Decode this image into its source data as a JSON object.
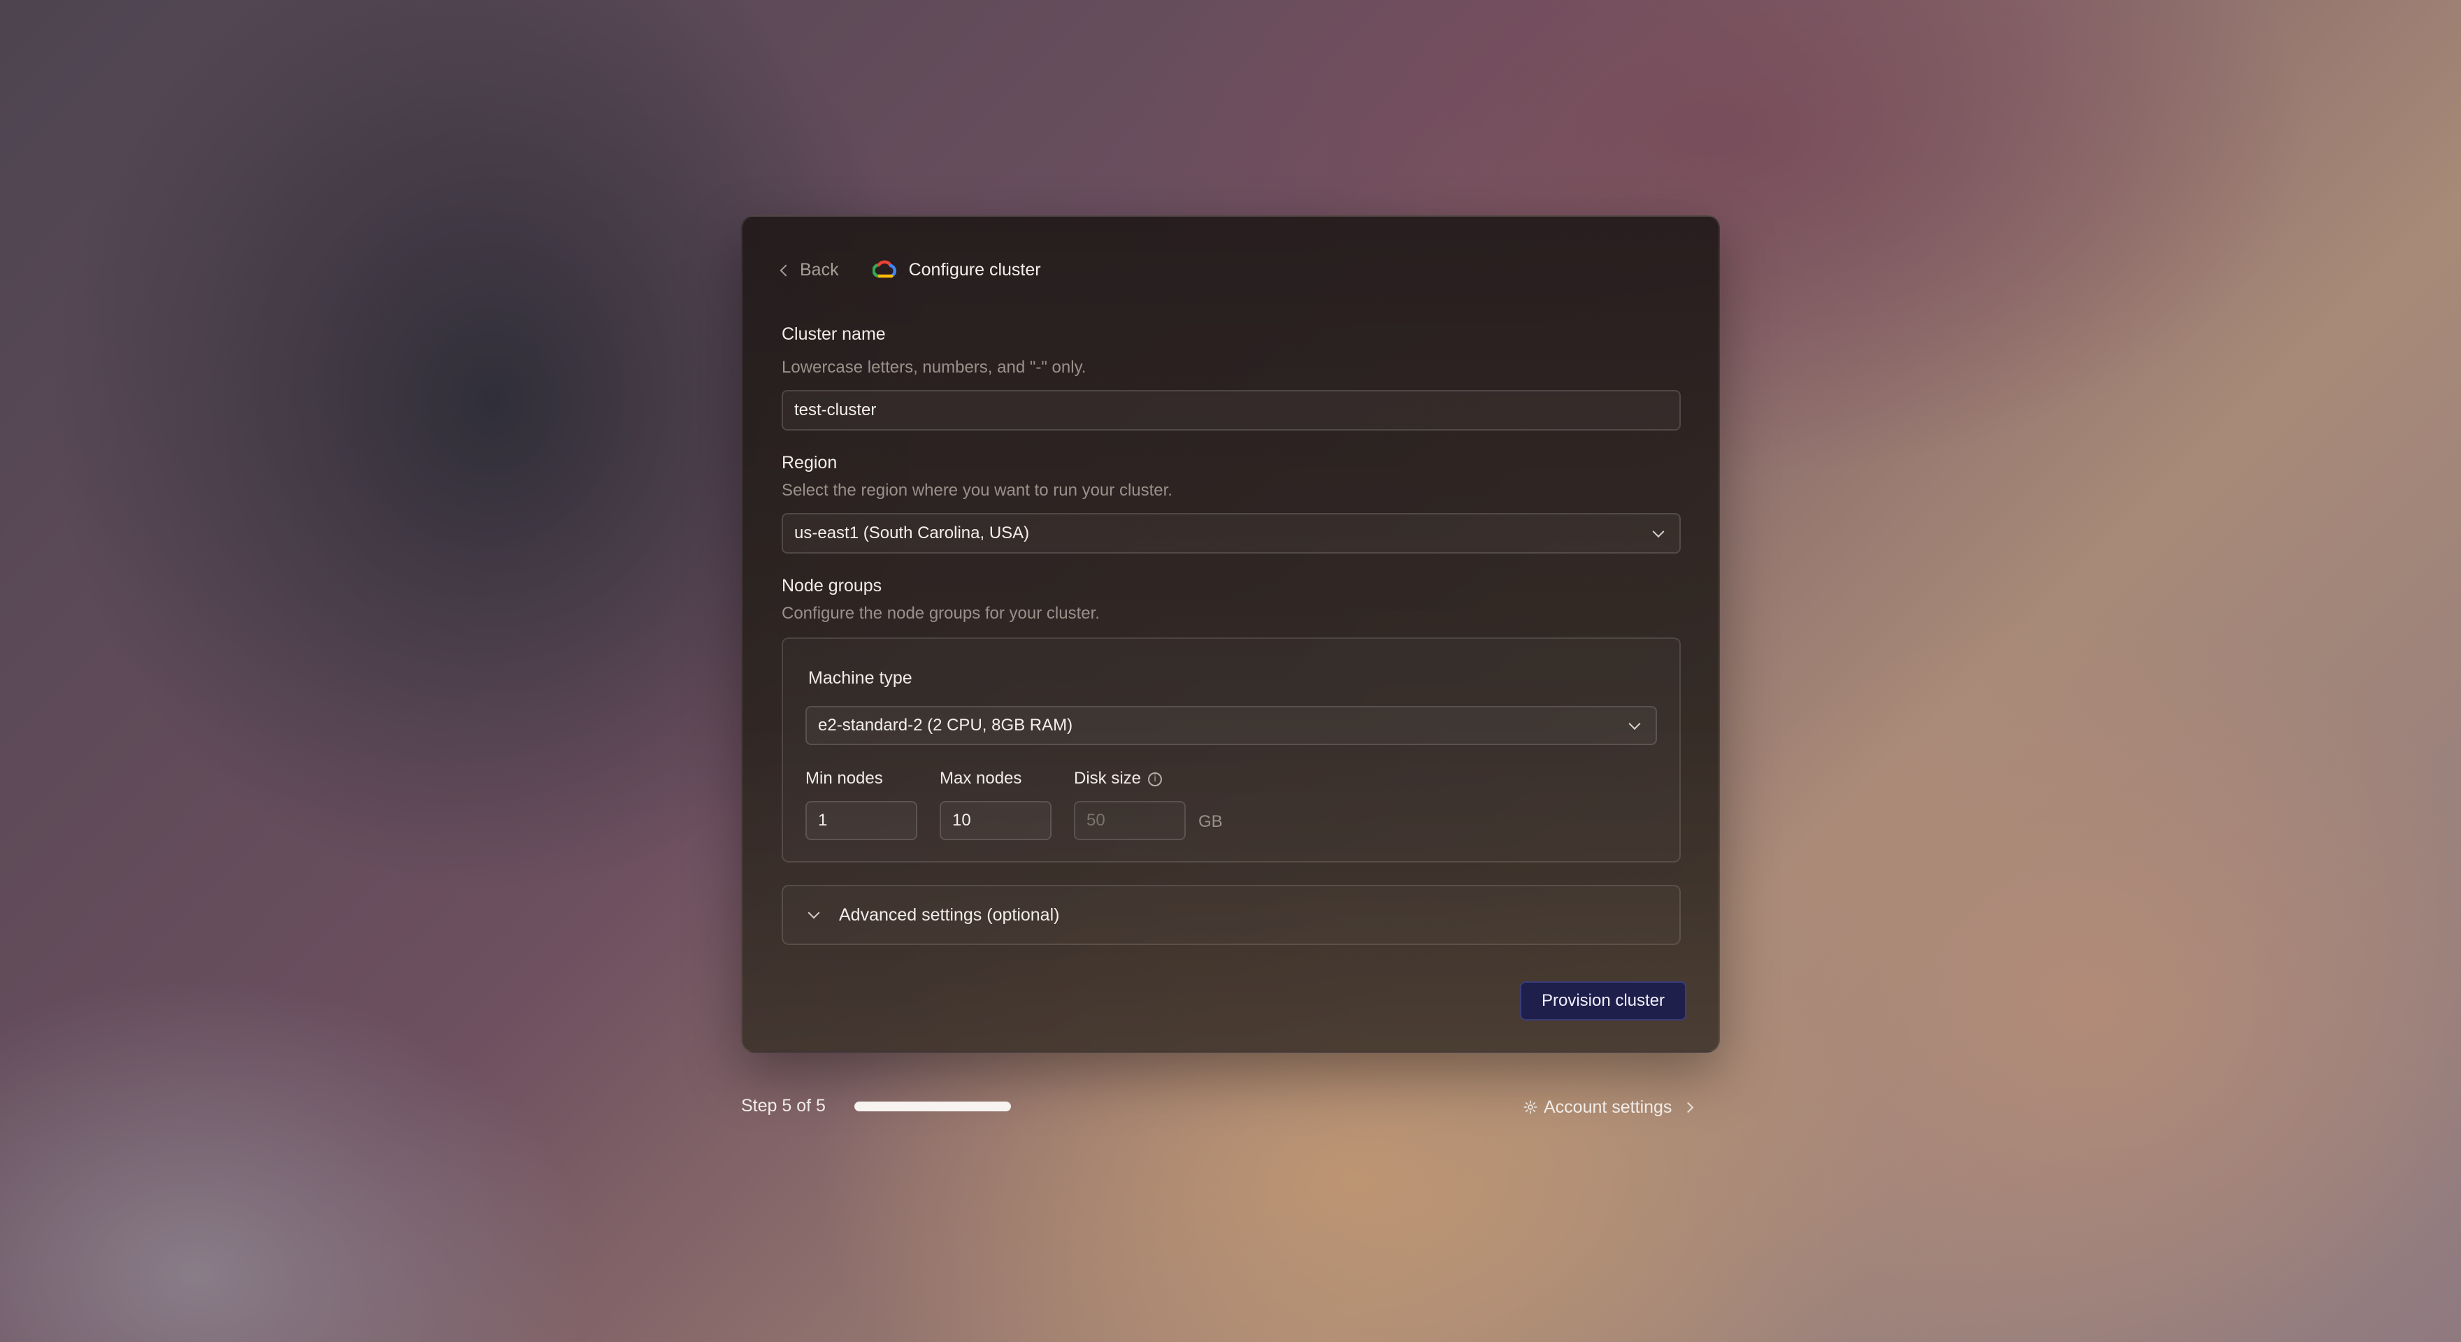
{
  "header": {
    "back_label": "Back",
    "title": "Configure cluster"
  },
  "cluster_name": {
    "label": "Cluster name",
    "hint": "Lowercase letters, numbers, and \"-\" only.",
    "value": "test-cluster"
  },
  "region": {
    "label": "Region",
    "hint": "Select the region where you want to run your cluster.",
    "selected": "us-east1 (South Carolina, USA)"
  },
  "node_groups": {
    "label": "Node groups",
    "hint": "Configure the node groups for your cluster.",
    "machine_type": {
      "label": "Machine type",
      "selected": "e2-standard-2 (2 CPU, 8GB RAM)"
    },
    "min_nodes": {
      "label": "Min nodes",
      "value": "1"
    },
    "max_nodes": {
      "label": "Max nodes",
      "value": "10"
    },
    "disk_size": {
      "label": "Disk size",
      "placeholder": "50",
      "unit": "GB"
    }
  },
  "advanced": {
    "label": "Advanced settings (optional)"
  },
  "actions": {
    "provision_label": "Provision cluster"
  },
  "footer": {
    "step_label": "Step 5 of 5",
    "progress_fraction": 1.0,
    "account_settings_label": "Account settings"
  },
  "icons": {
    "back": "chevron-left-icon",
    "provider": "google-cloud-icon",
    "select": "chevron-down-icon",
    "info": "info-icon",
    "expand": "chevron-down-icon",
    "settings": "gear-icon",
    "forward": "chevron-right-icon"
  },
  "colors": {
    "primary_button": "#1e1f4a",
    "progress_fill": "#f7f3f0"
  }
}
